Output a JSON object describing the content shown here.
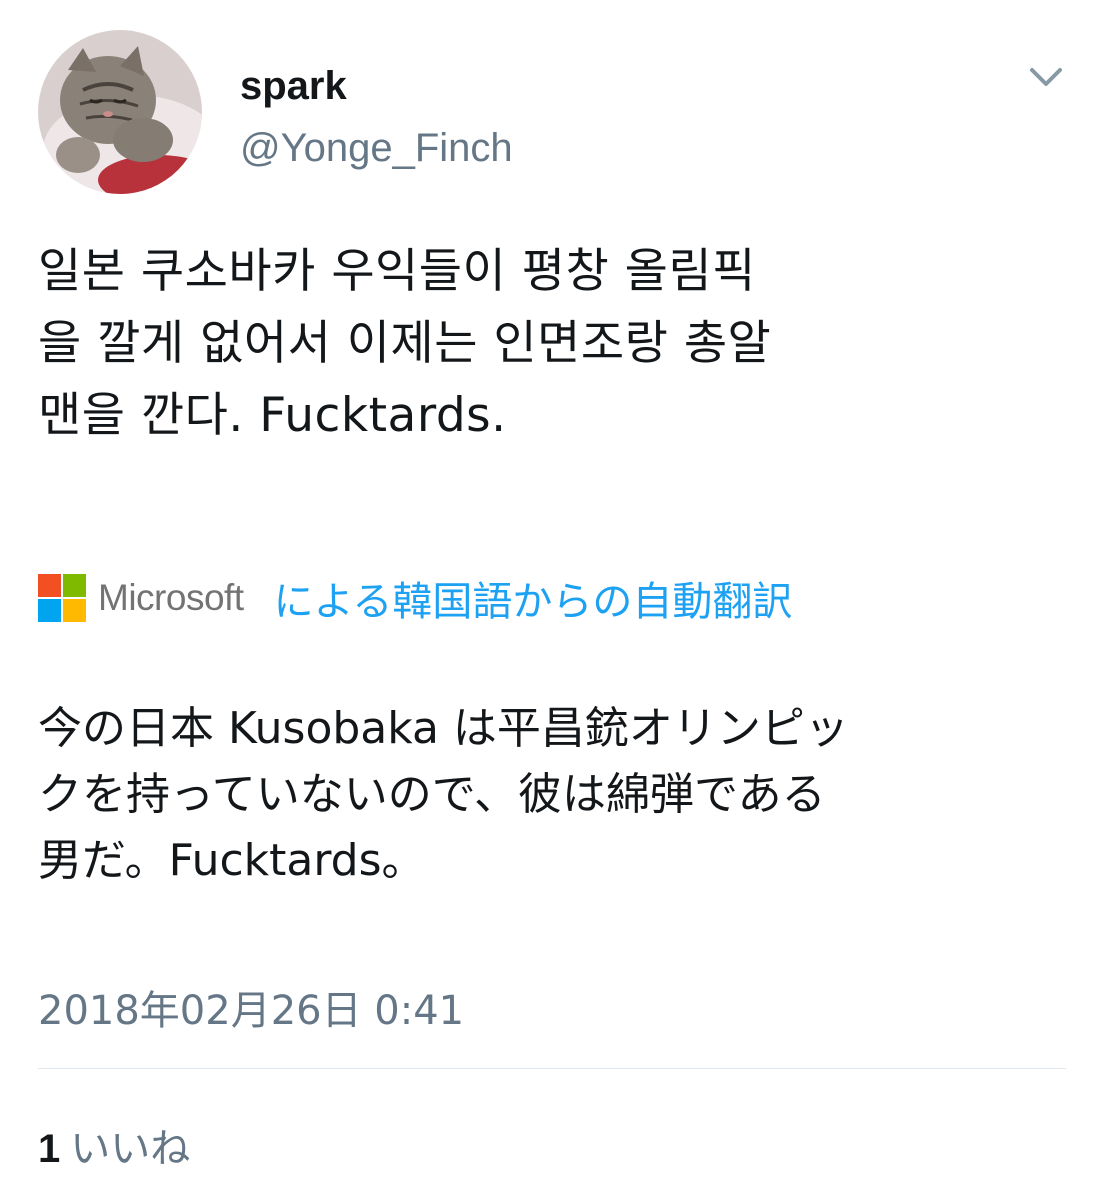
{
  "user": {
    "display_name": "spark",
    "handle": "@Yonge_Finch"
  },
  "tweet": {
    "text": "일본 쿠소바카 우익들이 평창 올림픽\n을 깔게 없어서 이제는 인면조랑 총알\n맨을 깐다. Fucktards.",
    "translation_provider": "Microsoft",
    "translation_link": "による韓国語からの自動翻訳",
    "translated_text": "今の日本 Kusobaka は平昌銃オリンピッ\nクを持っていないので、彼は綿弾である\n男だ。Fucktards。",
    "timestamp": "2018年02月26日 0:41"
  },
  "stats": {
    "likes_count": "1",
    "likes_label": "いいね"
  },
  "icons": {
    "menu": "chevron-down-icon",
    "provider_logo": "microsoft-logo-icon"
  },
  "colors": {
    "link": "#1da1f2",
    "secondary_text": "#657786",
    "primary_text": "#14171a",
    "divider": "#e1e8ed",
    "ms_red": "#f25022",
    "ms_green": "#7fba00",
    "ms_blue": "#00a4ef",
    "ms_yellow": "#ffb900"
  }
}
